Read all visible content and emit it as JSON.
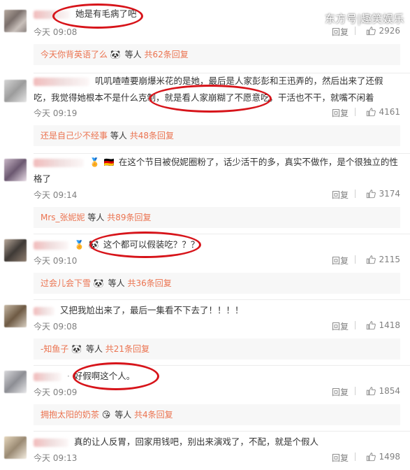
{
  "watermark": "东方号|趣笑娱乐",
  "colors": {
    "link": "#eb7350",
    "highlight": "#d7141a"
  },
  "ui": {
    "reply": "回复",
    "others": "等人"
  },
  "comments": [
    {
      "text": "她是有毛病了吧",
      "time": "今天 09:08",
      "likes": "2926",
      "sub": {
        "name": "今天你背英语了么",
        "emoji": "🐼",
        "total": "共62条回复"
      }
    },
    {
      "text": "叽叽喳喳要崩爆米花的是她，最后是人家彭彭和王迅弄的，然后出来了还假吃，我觉得她根本不是什么克制，就是看人家崩糊了不愿意吃，干活也不干，就嘴不闲着",
      "time": "今天 09:19",
      "likes": "4161",
      "sub": {
        "name": "还是自己少不经事",
        "emoji": "",
        "total": "共48条回复"
      }
    },
    {
      "text": "在这个节目被倪妮圈粉了，话少活干的多，真实不做作，是个很独立的性格了",
      "time": "今天 09:14",
      "likes": "3174",
      "sub": {
        "name": "Mrs_张妮妮",
        "emoji": "",
        "total": "共89条回复"
      }
    },
    {
      "text": "这个都可以假装吃？？？",
      "time": "今天 09:10",
      "likes": "2115",
      "sub": {
        "name": "过会儿会下雪",
        "emoji": "🐼",
        "total": "共36条回复"
      }
    },
    {
      "text": "又把我尬出来了，最后一集看不下去了！！！！",
      "time": "今天 09:08",
      "likes": "1418",
      "sub": {
        "name": "-知鱼子",
        "emoji": "🐼",
        "total": "共21条回复"
      }
    },
    {
      "text": "好假啊这个人。",
      "time": "今天 09:09",
      "likes": "1854",
      "sub": {
        "name": "拥抱太阳的奶茶",
        "emoji": "😘",
        "total": "共4条回复"
      }
    },
    {
      "text": "真的让人反胃，回家用钱吧，别出来演戏了，不配，就是个假人",
      "time": "今天 09:13",
      "likes": "1498"
    }
  ]
}
